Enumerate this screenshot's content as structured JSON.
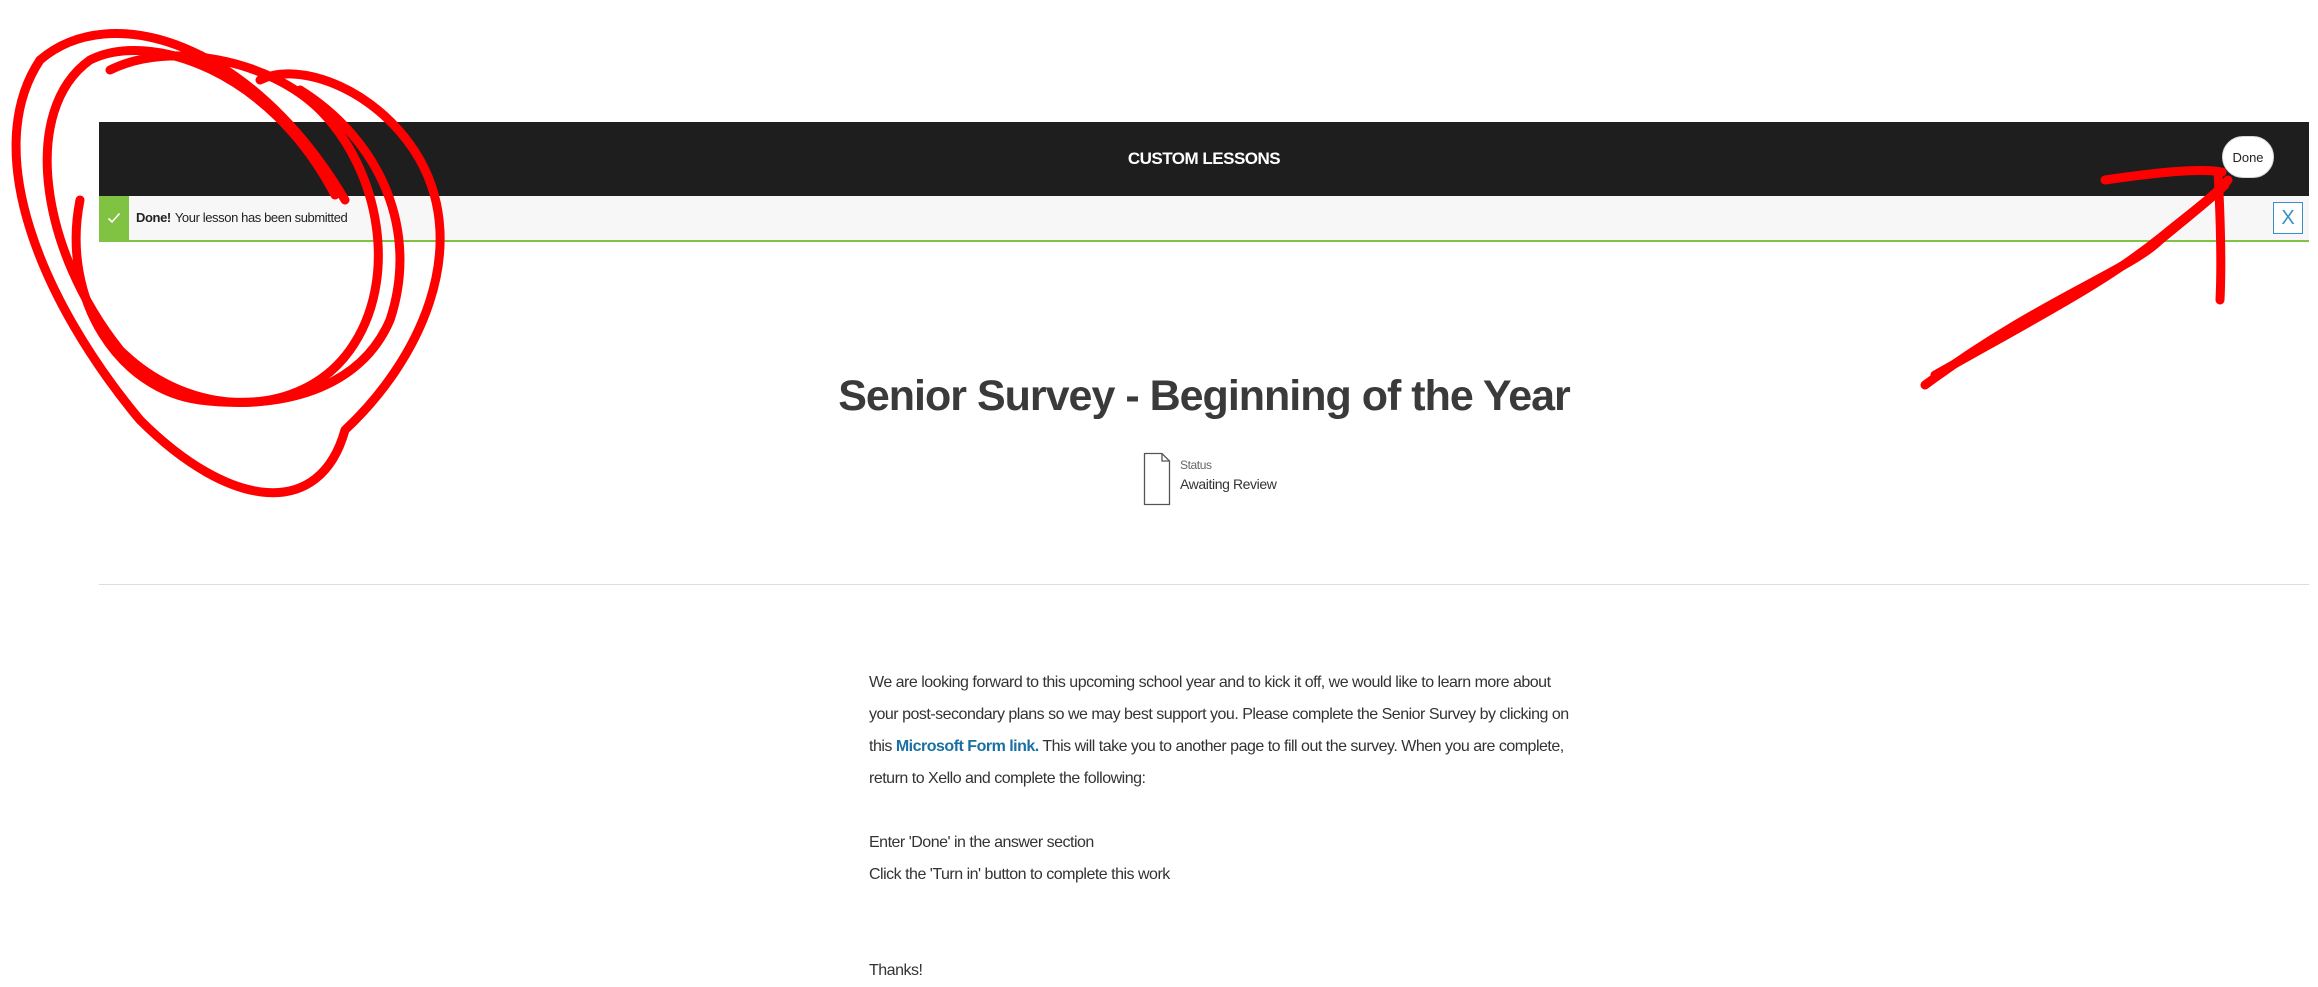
{
  "header": {
    "title": "CUSTOM LESSONS",
    "done_label": "Done"
  },
  "alert": {
    "strong": "Done!",
    "message": "Your lesson has been submitted",
    "close_label": "X",
    "color": "#80c342"
  },
  "lesson": {
    "title": "Senior Survey - Beginning of the Year",
    "status_label": "Status",
    "status_value": "Awaiting Review"
  },
  "body": {
    "p1_part1": "We are looking forward to this upcoming school year and to kick it off, we would like to learn more about your post-secondary plans so we may best support you. Please complete the Senior Survey by clicking on this ",
    "link_text": "Microsoft Form link.",
    "p1_part2": " This will take you to another page to fill out the survey. When you are complete, return to Xello and complete the following:",
    "line1": "Enter 'Done' in the answer section",
    "line2": "Click the 'Turn in' button to complete this work",
    "thanks": "Thanks!"
  },
  "annotation": {
    "color": "#ff0000"
  }
}
